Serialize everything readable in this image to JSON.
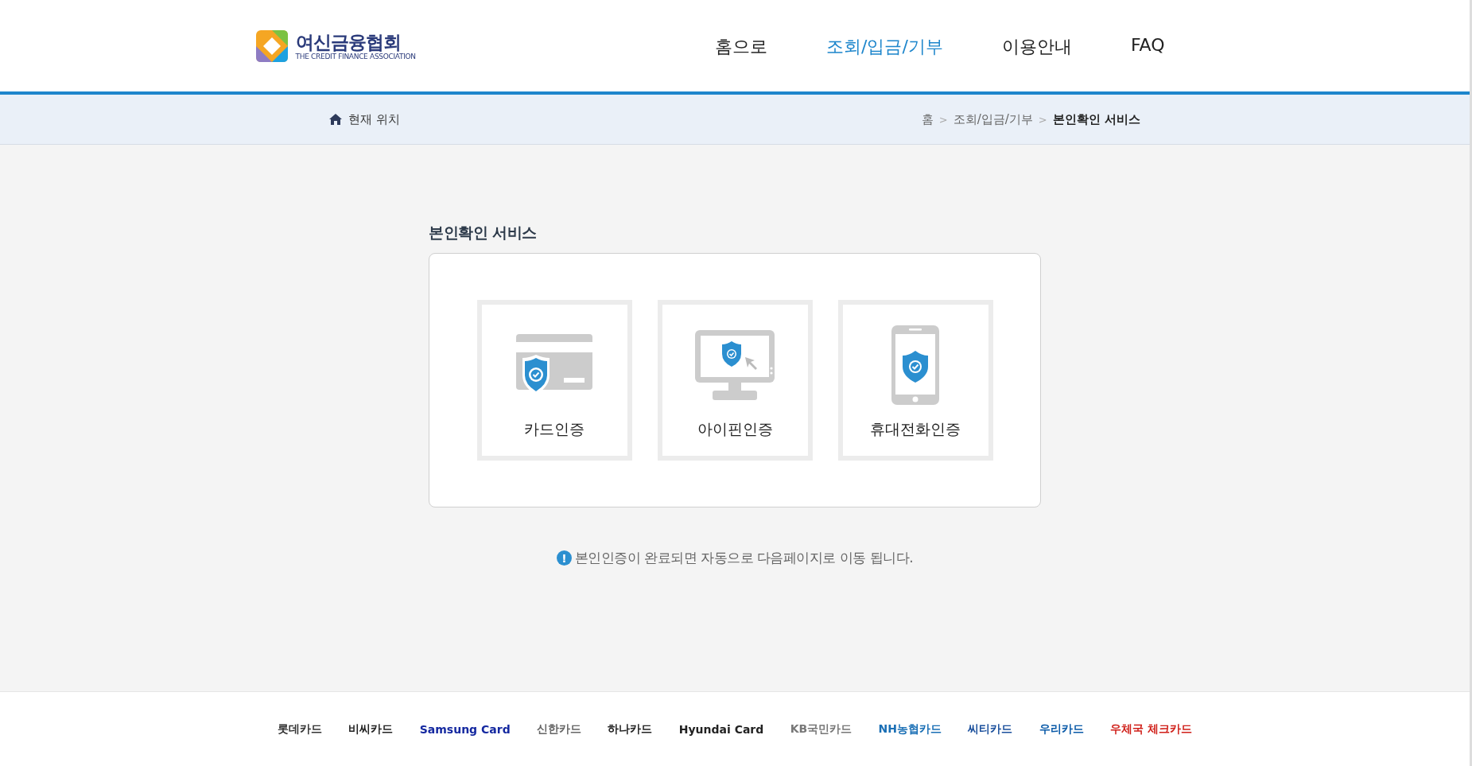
{
  "header": {
    "logo": {
      "name": "여신금융협회",
      "subtitle": "THE CREDIT FINANCE ASSOCIATION"
    },
    "nav": [
      {
        "label": "홈으로",
        "selected": false
      },
      {
        "label": "조회/입금/기부",
        "selected": true
      },
      {
        "label": "이용안내",
        "selected": false
      },
      {
        "label": "FAQ",
        "selected": false
      }
    ]
  },
  "breadcrumb": {
    "location_label": "현재 위치",
    "separator": ">",
    "path": [
      "홈",
      "조회/입금/기부",
      "본인확인 서비스"
    ]
  },
  "section_title": "본인확인 서비스",
  "methods": [
    {
      "kind": "card",
      "label": "카드인증"
    },
    {
      "kind": "ipin",
      "label": "아이핀인증"
    },
    {
      "kind": "phone",
      "label": "휴대전화인증"
    }
  ],
  "notice": "본인인증이 완료되면 자동으로 다음페이지로 이동 됩니다.",
  "notice_icon": "!",
  "partners": [
    {
      "label": "롯데카드",
      "color": "#333333"
    },
    {
      "label": "비씨카드",
      "color": "#222222"
    },
    {
      "label": "Samsung Card",
      "color": "#1428a0"
    },
    {
      "label": "신한카드",
      "color": "#666666"
    },
    {
      "label": "하나카드",
      "color": "#222222"
    },
    {
      "label": "Hyundai Card",
      "color": "#222222"
    },
    {
      "label": "KB국민카드",
      "color": "#777777"
    },
    {
      "label": "NH농협카드",
      "color": "#1a6fb5"
    },
    {
      "label": "씨티카드",
      "color": "#1a4f9c"
    },
    {
      "label": "우리카드",
      "color": "#0a5aa8"
    },
    {
      "label": "우체국 체크카드",
      "color": "#d0201a"
    }
  ]
}
